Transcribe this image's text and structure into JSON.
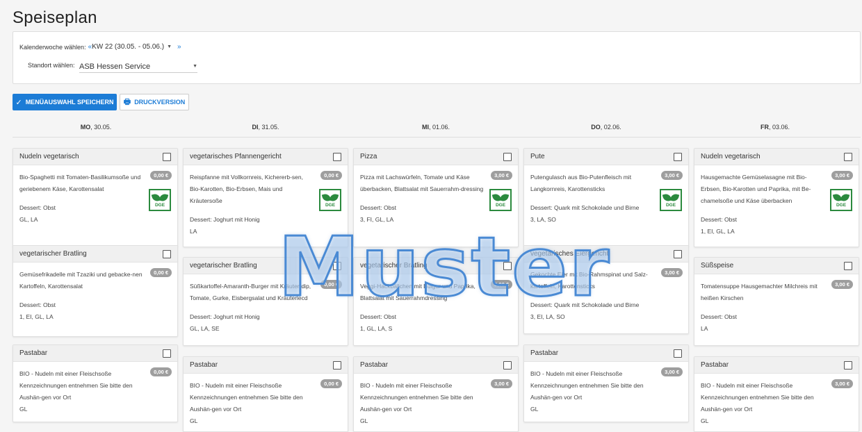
{
  "page": {
    "title": "Speiseplan"
  },
  "filters": {
    "week_label": "Kalenderwoche wählen:",
    "week_prev": "«",
    "week_value": "KW 22 (30.05. - 05.06.)",
    "week_next": "»",
    "location_label": "Standort wählen:",
    "location_value": "ASB Hessen Service"
  },
  "actions": {
    "save_label": "MENÜAUSWAHL SPEICHERN",
    "print_label": "DRUCKVERSION"
  },
  "days": [
    {
      "abbr": "MO",
      "date": ", 30.05."
    },
    {
      "abbr": "DI",
      "date": ", 31.05."
    },
    {
      "abbr": "MI",
      "date": ", 01.06."
    },
    {
      "abbr": "DO",
      "date": ", 02.06."
    },
    {
      "abbr": "FR",
      "date": ", 03.06."
    }
  ],
  "menu": [
    [
      {
        "title": "Nudeln vegetarisch",
        "price": "0,00 €",
        "desc": "Bio-Spaghetti mit Tomaten-Basilikumsoße und geriebenem Käse, Karottensalat",
        "dessert": "Dessert: Obst",
        "allergens": "GL, LA",
        "dge": true
      },
      {
        "title": "vegetarischer Bratling",
        "price": "0,00 €",
        "desc": "Gemüsefrikadelle mit Tzaziki und gebacke-nen Kartoffeln, Karottensalat",
        "dessert": "Dessert: Obst",
        "allergens": "1, EI, GL, LA",
        "dge": false
      },
      {
        "title": "Pastabar",
        "price": "0,00 €",
        "desc": "BIO - Nudeln mit einer Fleischsoße Kennzeichnungen entnehmen Sie bitte den Aushän-gen vor Ort",
        "dessert": "",
        "allergens": "GL",
        "dge": false
      }
    ],
    [
      {
        "title": "vegetarisches Pfannengericht",
        "price": "0,00 €",
        "desc": "Reispfanne mit Vollkornreis, Kichererb-sen, Bio-Karotten, Bio-Erbsen, Mais und Kräutersoße",
        "dessert": "Dessert: Joghurt mit Honig",
        "allergens": "LA",
        "dge": true
      },
      {
        "title": "vegetarischer Bratling",
        "price": "0,00 €",
        "desc": "Süßkartoffel-Amaranth-Burger mit Kräuter-dip, Tomate, Gurke, Eisbergsalat und Kräuterlecd",
        "dessert": "Dessert: Joghurt mit Honig",
        "allergens": "GL, LA, SE",
        "dge": false
      },
      {
        "title": "Pastabar",
        "price": "0,00 €",
        "desc": "BIO - Nudeln mit einer Fleischsoße Kennzeichnungen entnehmen Sie bitte den Aushän-gen vor Ort",
        "dessert": "",
        "allergens": "GL",
        "dge": false
      }
    ],
    [
      {
        "title": "Pizza",
        "price": "3,00 €",
        "desc": "Pizza mit Lachswürfeln, Tomate und Käse überbacken, Blattsalat mit Sauerrahm-dressing",
        "dessert": "Dessert: Obst",
        "allergens": "3, FI, GL, LA",
        "dge": true
      },
      {
        "title": "vegetarischer Bratling",
        "price": "3,00 €",
        "desc": "Veggi-Hackbällchen mit Bulgur und Paprika, Blattsalat mit Sauerrahmdressing",
        "dessert": "Dessert: Obst",
        "allergens": "1, GL, LA, S",
        "dge": false
      },
      {
        "title": "Pastabar",
        "price": "3,00 €",
        "desc": "BIO - Nudeln mit einer Fleischsoße Kennzeichnungen entnehmen Sie bitte den Aushän-gen vor Ort",
        "dessert": "",
        "allergens": "GL",
        "dge": false
      }
    ],
    [
      {
        "title": "Pute",
        "price": "3,00 €",
        "desc": "Putengulasch aus Bio-Putenfleisch mit Langkornreis, Karottensticks",
        "dessert": "Dessert: Quark mit Schokolade und Birne",
        "allergens": "3, LA, SO",
        "dge": true
      },
      {
        "title": "vegetarisches Eiergericht",
        "price": "3,00 €",
        "desc": "Gekochte Eier mit Bio-Rahmspinat und Salz-kartoffeln, Karottensticks",
        "dessert": "Dessert: Quark mit Schokolade und Birne",
        "allergens": "3, EI, LA, SO",
        "dge": false
      },
      {
        "title": "Pastabar",
        "price": "3,00 €",
        "desc": "BIO - Nudeln mit einer Fleischsoße Kennzeichnungen entnehmen Sie bitte den Aushän-gen vor Ort",
        "dessert": "",
        "allergens": "GL",
        "dge": false
      }
    ],
    [
      {
        "title": "Nudeln vegetarisch",
        "price": "3,00 €",
        "desc": "Hausgemachte Gemüselasagne mit Bio-Erbsen, Bio-Karotten und Paprika, mit Be-chamelsoße und Käse überbacken",
        "dessert": "Dessert: Obst",
        "allergens": "1, EI, GL, LA",
        "dge": true
      },
      {
        "title": "Süßspeise",
        "price": "3,00 €",
        "desc": "Tomatensuppe Hausgemachter Milchreis mit heißen Kirschen",
        "dessert": "Dessert: Obst",
        "allergens": "LA",
        "dge": false
      },
      {
        "title": "Pastabar",
        "price": "3,00 €",
        "desc": "BIO - Nudeln mit einer Fleischsoße Kennzeichnungen entnehmen Sie bitte den Aushän-gen vor Ort",
        "dessert": "",
        "allergens": "GL",
        "dge": false
      }
    ]
  ],
  "dge_label": "DGE",
  "watermark": "Muster"
}
